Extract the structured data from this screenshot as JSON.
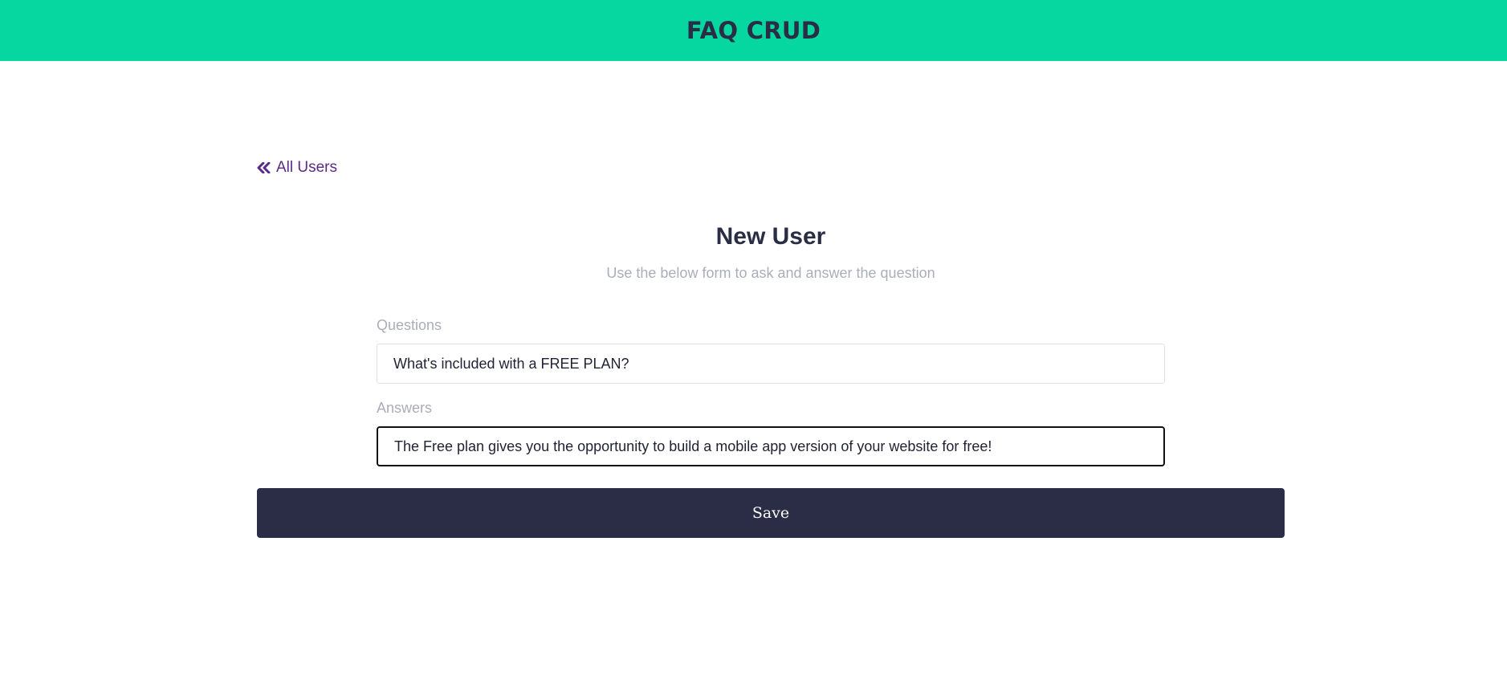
{
  "header": {
    "title": "FAQ CRUD"
  },
  "nav": {
    "back_label": "All Users",
    "back_icon": "double-chevron-left-icon"
  },
  "form": {
    "title": "New User",
    "subtitle": "Use the below form to ask and answer the question",
    "questions_label": "Questions",
    "questions_value": "What's included with a FREE PLAN?",
    "answers_label": "Answers",
    "answers_value": "The Free plan gives you the opportunity to build a mobile app version of your website for free!",
    "save_label": "Save"
  },
  "colors": {
    "header_bg": "#06d6a0",
    "title_text": "#2a2e45",
    "link": "#5b2a86",
    "muted_text": "#a9aeb8",
    "button_bg": "#2a2d45",
    "button_text": "#ffffff"
  }
}
